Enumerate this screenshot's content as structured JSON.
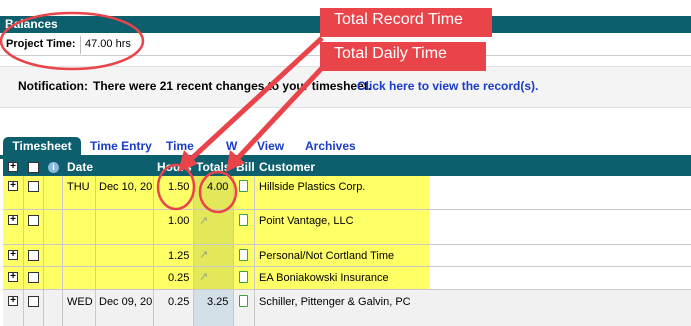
{
  "balances": {
    "title": "Balances",
    "project_time_label": "Project Time:",
    "project_time_value": "47.00 hrs"
  },
  "notification": {
    "label": "Notification:",
    "text": "There were 21 recent changes to your timesheet.",
    "link": "Click here to view the record(s)."
  },
  "tabs": [
    {
      "label": "Timesheet",
      "active": true
    },
    {
      "label": "Time Entry"
    },
    {
      "label": "Time"
    },
    {
      "label": "W"
    },
    {
      "label": "View"
    },
    {
      "label": "Archives"
    }
  ],
  "columns": {
    "date": "Date",
    "hours": "Hours",
    "totals": "Totals",
    "bill": "Bill",
    "customer": "Customer"
  },
  "rows": [
    {
      "day": "THU",
      "date": "Dec 10, 20",
      "hours": "1.50",
      "totals": "4.00",
      "customer": "Hillside Plastics Corp."
    },
    {
      "day": "",
      "date": "",
      "hours": "1.00",
      "totals": "",
      "customer": "Point Vantage, LLC"
    },
    {
      "day": "",
      "date": "",
      "hours": "1.25",
      "totals": "",
      "customer": "Personal/Not Cortland Time"
    },
    {
      "day": "",
      "date": "",
      "hours": "0.25",
      "totals": "",
      "customer": "EA Boniakowski Insurance"
    },
    {
      "day": "WED",
      "date": "Dec 09, 20",
      "hours": "0.25",
      "totals": "3.25",
      "customer": "Schiller, Pittenger & Galvin, PC"
    }
  ],
  "callouts": {
    "record": "Total Record Time",
    "daily": "Total Daily Time"
  },
  "colors": {
    "teal": "#0d5f6e",
    "highlight": "#ffff66",
    "annotation": "#e8444a",
    "link": "#1a3cc8"
  }
}
